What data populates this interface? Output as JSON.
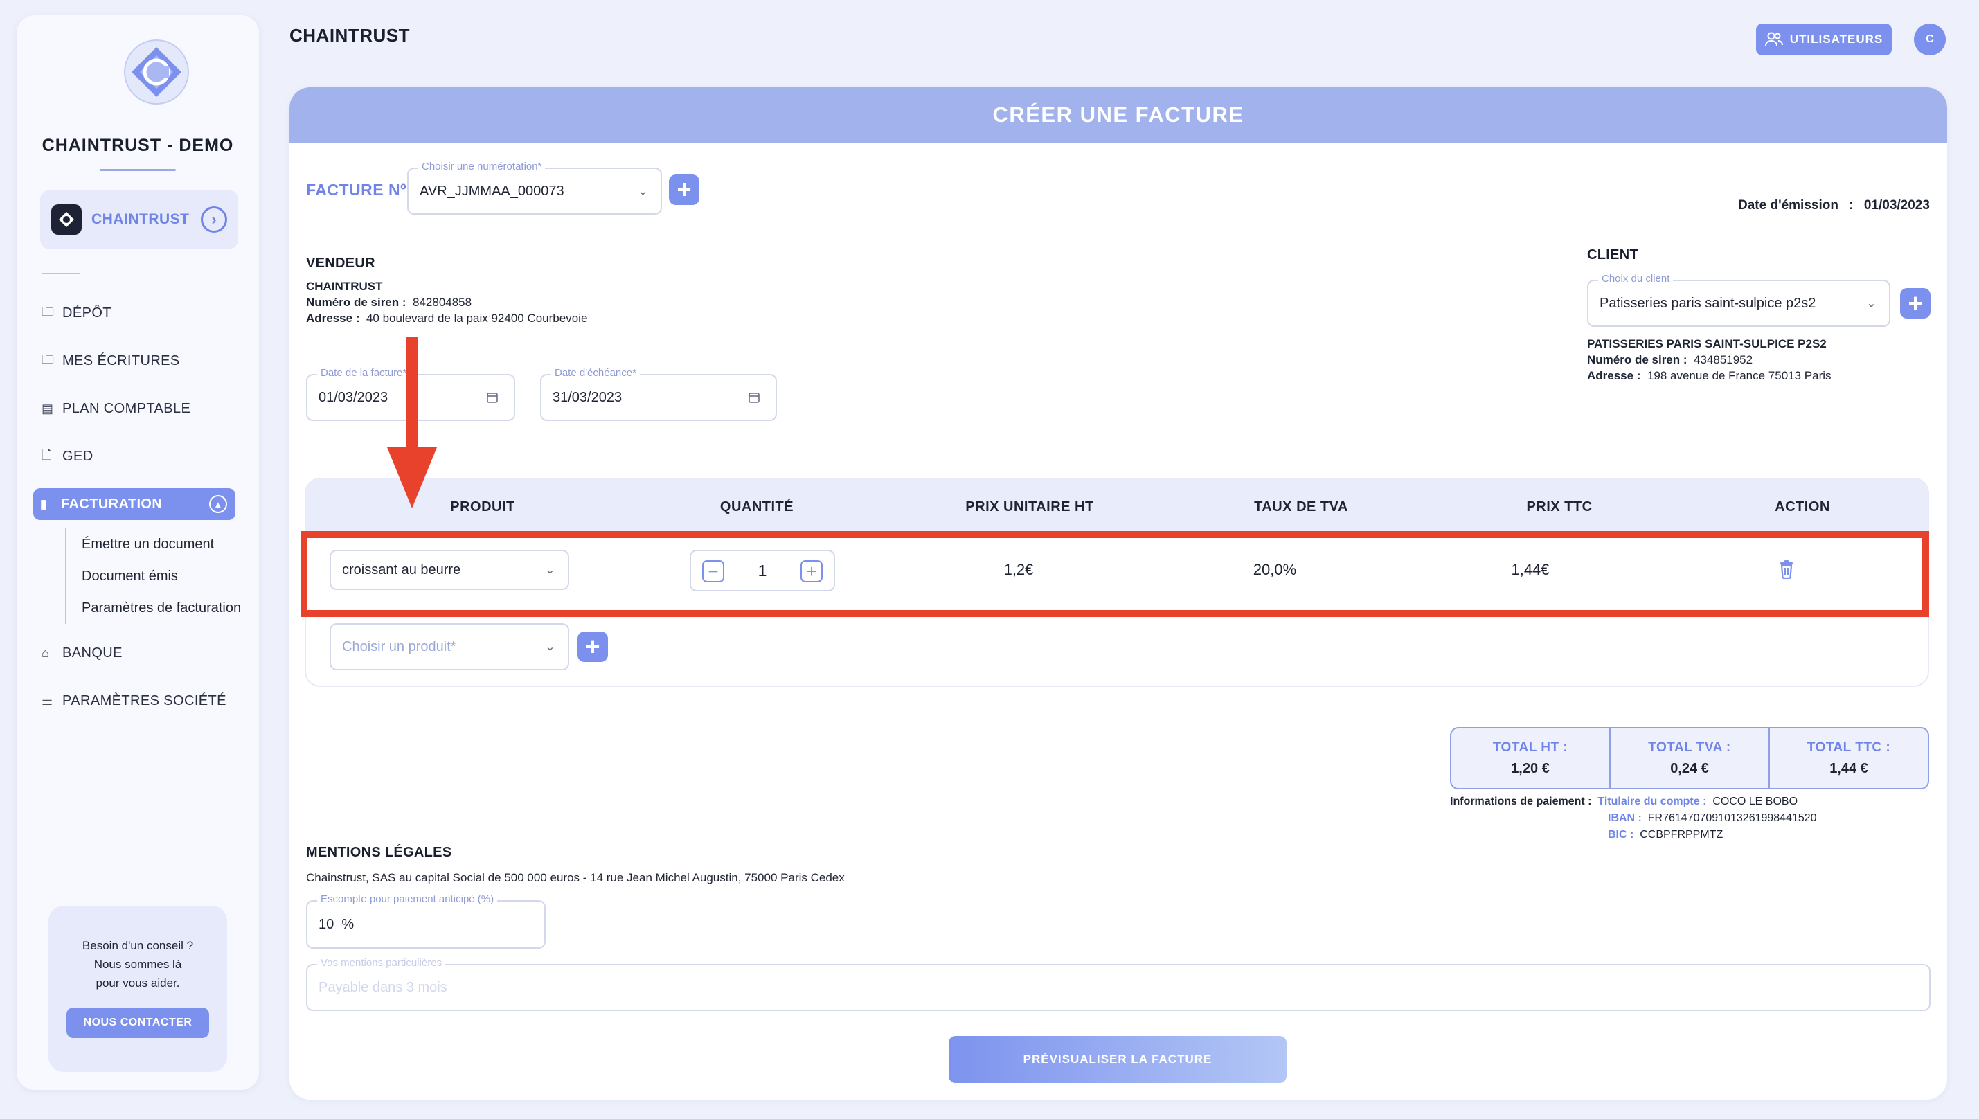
{
  "sidebar": {
    "app_title": "CHAINTRUST - DEMO",
    "company_label": "CHAINTRUST",
    "nav": {
      "depot": "DÉPÔT",
      "ecritures": "MES ÉCRITURES",
      "plan": "PLAN COMPTABLE",
      "ged": "GED",
      "facturation": "FACTURATION",
      "banque": "BANQUE",
      "parametres": "PARAMÈTRES SOCIÉTÉ"
    },
    "subnav": [
      "Émettre un document",
      "Document émis",
      "Paramètres de facturation"
    ],
    "help": {
      "line1": "Besoin d'un conseil ?",
      "line2": "Nous sommes là",
      "line3": "pour vous aider.",
      "button": "NOUS CONTACTER"
    }
  },
  "topbar": {
    "title": "CHAINTRUST",
    "users_button": "UTILISATEURS",
    "avatar_letter": "C"
  },
  "invoice": {
    "header": "CRÉER UNE FACTURE",
    "number_label": "FACTURE Nº",
    "numbering_legend": "Choisir une numérotation*",
    "numbering_value": "AVR_JJMMAA_000073",
    "issue_date_label": "Date d'émission",
    "issue_date_sep": ":",
    "issue_date": "01/03/2023",
    "seller": {
      "title": "VENDEUR",
      "name": "CHAINTRUST",
      "siren_label": "Numéro de siren :",
      "siren": "842804858",
      "address_label": "Adresse :",
      "address": "40 boulevard de la paix 92400 Courbevoie"
    },
    "invoice_date_legend": "Date de la facture*",
    "invoice_date": "01/03/2023",
    "due_date_legend": "Date d'échéance*",
    "due_date": "31/03/2023",
    "client": {
      "title": "CLIENT",
      "legend": "Choix du client",
      "value": "Patisseries paris saint-sulpice p2s2",
      "name": "PATISSERIES PARIS SAINT-SULPICE P2S2",
      "siren_label": "Numéro de siren :",
      "siren": "434851952",
      "address_label": "Adresse :",
      "address": "198 avenue de France 75013 Paris"
    },
    "table": {
      "headers": [
        "PRODUIT",
        "QUANTITÉ",
        "PRIX UNITAIRE HT",
        "TAUX DE TVA",
        "PRIX TTC",
        "ACTION"
      ],
      "row": {
        "product": "croissant au beurre",
        "quantity": "1",
        "unit_price": "1,2€",
        "vat": "20,0%",
        "price_ttc": "1,44€"
      },
      "new_product_placeholder": "Choisir un produit*"
    },
    "totals": {
      "ht_label": "TOTAL HT :",
      "ht": "1,20 €",
      "tva_label": "TOTAL TVA :",
      "tva": "0,24 €",
      "ttc_label": "TOTAL TTC :",
      "ttc": "1,44 €"
    },
    "payment": {
      "title": "Informations de paiement :",
      "holder_label": "Titulaire du compte :",
      "holder": "COCO LE BOBO",
      "iban_label": "IBAN :",
      "iban": "FR7614707091013261998441520",
      "bic_label": "BIC :",
      "bic": "CCBPFRPPMTZ"
    },
    "legal": {
      "title": "MENTIONS LÉGALES",
      "text": "Chainstrust, SAS au capital Social de 500 000 euros - 14 rue Jean Michel Augustin, 75000 Paris Cedex",
      "discount_legend": "Escompte pour paiement anticipé (%)",
      "discount_value": "10",
      "discount_unit": "%",
      "mentions_legend": "Vos mentions particulières",
      "mentions_placeholder": "Payable dans 3 mois"
    },
    "preview_button": "PRÉVISUALISER LA FACTURE"
  },
  "colors": {
    "accent": "#7c91ee",
    "header": "#a2b2ec",
    "annotation": "#e8412c"
  }
}
